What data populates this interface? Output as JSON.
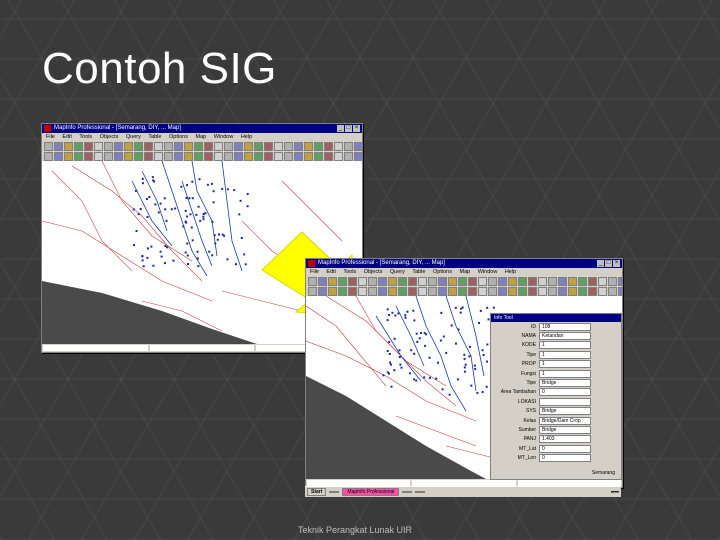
{
  "slide": {
    "title": "Contoh SIG",
    "footer": "Teknik Perangkat Lunak UIR"
  },
  "colors": {
    "background": "#3a3a3a",
    "titlebar": "#000080",
    "arrow": "#ffff00",
    "sea": "#4a4a4a",
    "roads": "#c04040",
    "rivers": "#1a3aa0",
    "taskbar_active": "#ff4da6"
  },
  "app_window_1": {
    "title": "MapInfo Professional - [Semarang, DIY, ... Map]",
    "menu": [
      "File",
      "Edit",
      "Tools",
      "Objects",
      "Query",
      "Table",
      "Options",
      "Map",
      "Window",
      "Help"
    ],
    "status": [
      "",
      "",
      ""
    ]
  },
  "app_window_2": {
    "title": "MapInfo Professional - [Semarang, DIY, ... Map]",
    "menu": [
      "File",
      "Edit",
      "Tools",
      "Objects",
      "Query",
      "Table",
      "Options",
      "Map",
      "Window",
      "Help"
    ],
    "status": [
      "",
      "",
      ""
    ]
  },
  "info_tool": {
    "title": "Info Tool",
    "rows": [
      {
        "key": "ID",
        "value": "108"
      },
      {
        "key": "NAMA",
        "value": "Ketandan"
      },
      {
        "key": "KODE",
        "value": "1"
      },
      {
        "key": "Tipe",
        "value": "1"
      },
      {
        "key": "PROP",
        "value": "1"
      },
      {
        "key": "Fungsi",
        "value": "1"
      },
      {
        "key": "Tipe",
        "value": "Bridge"
      },
      {
        "key": "Area Tambahan",
        "value": "0"
      },
      {
        "key": "LOKASI",
        "value": ""
      },
      {
        "key": "SYS",
        "value": "Bridge"
      },
      {
        "key": "Kelas",
        "value": "Bridge/Dam Crop"
      },
      {
        "key": "Sumber",
        "value": "Bridge"
      },
      {
        "key": "PANJ",
        "value": "1.403"
      },
      {
        "key": "MT_Lat",
        "value": "0"
      },
      {
        "key": "MT_Lon",
        "value": "0"
      }
    ],
    "footer": "Semarang"
  },
  "taskbar": {
    "start": "Start",
    "tasks": [
      "",
      "MapInfo Professional",
      "",
      ""
    ],
    "clock": ""
  }
}
